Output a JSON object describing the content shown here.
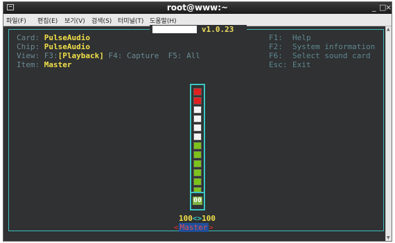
{
  "window": {
    "title": "root@www:~",
    "buttons": [
      "_",
      "□",
      "×"
    ]
  },
  "menu": [
    "파일(F)",
    "편집(E)",
    "보기(V)",
    "검색(S)",
    "터미널(T)",
    "도움말(H)"
  ],
  "app": {
    "version": "v1.0.23",
    "card_key": "Card: ",
    "card_value": "PulseAudio",
    "chip_key": "Chip: ",
    "chip_value": "PulseAudio",
    "view_key": "View: ",
    "view_f3_key": "F3:",
    "view_f3_value": "[Playback]",
    "view_f4": " F4: Capture  F5: All",
    "item_key": "Item: ",
    "item_value": "Master",
    "shortcuts": [
      {
        "key": "F1:",
        "label": "Help"
      },
      {
        "key": "F2:",
        "label": "System information"
      },
      {
        "key": "F6:",
        "label": "Select sound card"
      },
      {
        "key": "Esc:",
        "label": "Exit"
      }
    ],
    "meter_level_percent": 100,
    "mute_indicator": "00",
    "volume_left": "100",
    "volume_sep": "<>",
    "volume_right": "100",
    "control_bracket_left": "<",
    "control_name": "Master",
    "control_bracket_right": ">"
  },
  "colors": {
    "term_bg": "#2f3132",
    "accent_cyan": "#3cc6c6",
    "value_yellow": "#f2e04a",
    "meter_red": "#e02020",
    "meter_white": "#f4f4f4",
    "meter_green": "#7cc21c"
  }
}
